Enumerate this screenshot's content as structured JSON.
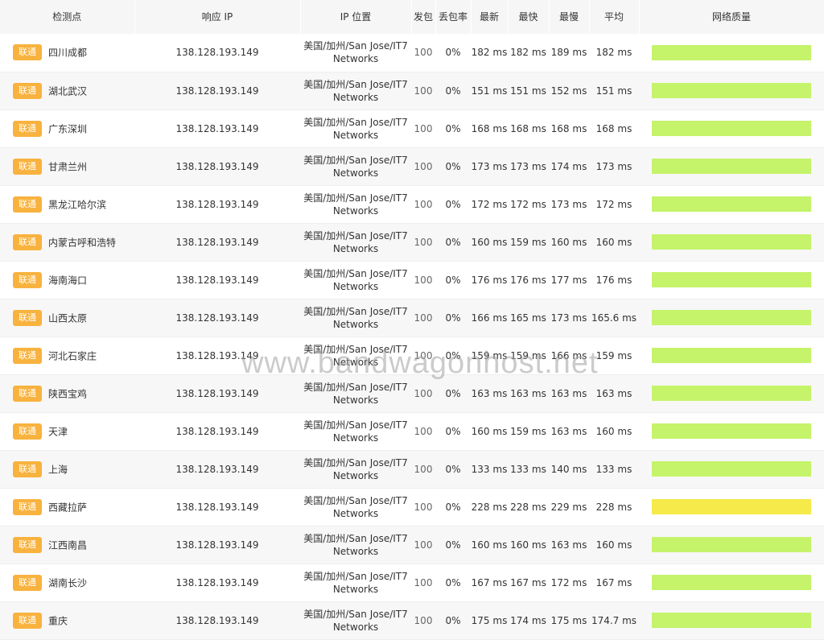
{
  "headers": {
    "point": "检测点",
    "ip": "响应 IP",
    "location": "IP 位置",
    "sent": "发包",
    "loss": "丢包率",
    "latest": "最新",
    "fastest": "最快",
    "slowest": "最慢",
    "average": "平均",
    "quality": "网络质量"
  },
  "isp_label": "联通",
  "colors": {
    "badge": "#f8b23e",
    "quality_good": "#c5f36a",
    "quality_fair": "#f6e94a"
  },
  "rows": [
    {
      "city": "四川成都",
      "ip": "138.128.193.149",
      "loc1": "美国/加州/San Jose/IT7",
      "loc2": "Networks",
      "sent": "100",
      "loss": "0%",
      "latest": "182 ms",
      "fastest": "182 ms",
      "slowest": "189 ms",
      "average": "182 ms",
      "quality": "good"
    },
    {
      "city": "湖北武汉",
      "ip": "138.128.193.149",
      "loc1": "美国/加州/San Jose/IT7",
      "loc2": "Networks",
      "sent": "100",
      "loss": "0%",
      "latest": "151 ms",
      "fastest": "151 ms",
      "slowest": "152 ms",
      "average": "151 ms",
      "quality": "good"
    },
    {
      "city": "广东深圳",
      "ip": "138.128.193.149",
      "loc1": "美国/加州/San Jose/IT7",
      "loc2": "Networks",
      "sent": "100",
      "loss": "0%",
      "latest": "168 ms",
      "fastest": "168 ms",
      "slowest": "168 ms",
      "average": "168 ms",
      "quality": "good"
    },
    {
      "city": "甘肃兰州",
      "ip": "138.128.193.149",
      "loc1": "美国/加州/San Jose/IT7",
      "loc2": "Networks",
      "sent": "100",
      "loss": "0%",
      "latest": "173 ms",
      "fastest": "173 ms",
      "slowest": "174 ms",
      "average": "173 ms",
      "quality": "good"
    },
    {
      "city": "黑龙江哈尔滨",
      "ip": "138.128.193.149",
      "loc1": "美国/加州/San Jose/IT7",
      "loc2": "Networks",
      "sent": "100",
      "loss": "0%",
      "latest": "172 ms",
      "fastest": "172 ms",
      "slowest": "173 ms",
      "average": "172 ms",
      "quality": "good"
    },
    {
      "city": "内蒙古呼和浩特",
      "ip": "138.128.193.149",
      "loc1": "美国/加州/San Jose/IT7",
      "loc2": "Networks",
      "sent": "100",
      "loss": "0%",
      "latest": "160 ms",
      "fastest": "159 ms",
      "slowest": "160 ms",
      "average": "160 ms",
      "quality": "good"
    },
    {
      "city": "海南海口",
      "ip": "138.128.193.149",
      "loc1": "美国/加州/San Jose/IT7",
      "loc2": "Networks",
      "sent": "100",
      "loss": "0%",
      "latest": "176 ms",
      "fastest": "176 ms",
      "slowest": "177 ms",
      "average": "176 ms",
      "quality": "good"
    },
    {
      "city": "山西太原",
      "ip": "138.128.193.149",
      "loc1": "美国/加州/San Jose/IT7",
      "loc2": "Networks",
      "sent": "100",
      "loss": "0%",
      "latest": "166 ms",
      "fastest": "165 ms",
      "slowest": "173 ms",
      "average": "165.6 ms",
      "quality": "good"
    },
    {
      "city": "河北石家庄",
      "ip": "138.128.193.149",
      "loc1": "美国/加州/San Jose/IT7",
      "loc2": "Networks",
      "sent": "100",
      "loss": "0%",
      "latest": "159 ms",
      "fastest": "159 ms",
      "slowest": "166 ms",
      "average": "159 ms",
      "quality": "good"
    },
    {
      "city": "陕西宝鸡",
      "ip": "138.128.193.149",
      "loc1": "美国/加州/San Jose/IT7",
      "loc2": "Networks",
      "sent": "100",
      "loss": "0%",
      "latest": "163 ms",
      "fastest": "163 ms",
      "slowest": "163 ms",
      "average": "163 ms",
      "quality": "good"
    },
    {
      "city": "天津",
      "ip": "138.128.193.149",
      "loc1": "美国/加州/San Jose/IT7",
      "loc2": "Networks",
      "sent": "100",
      "loss": "0%",
      "latest": "160 ms",
      "fastest": "159 ms",
      "slowest": "163 ms",
      "average": "160 ms",
      "quality": "good"
    },
    {
      "city": "上海",
      "ip": "138.128.193.149",
      "loc1": "美国/加州/San Jose/IT7",
      "loc2": "Networks",
      "sent": "100",
      "loss": "0%",
      "latest": "133 ms",
      "fastest": "133 ms",
      "slowest": "140 ms",
      "average": "133 ms",
      "quality": "good"
    },
    {
      "city": "西藏拉萨",
      "ip": "138.128.193.149",
      "loc1": "美国/加州/San Jose/IT7",
      "loc2": "Networks",
      "sent": "100",
      "loss": "0%",
      "latest": "228 ms",
      "fastest": "228 ms",
      "slowest": "229 ms",
      "average": "228 ms",
      "quality": "fair"
    },
    {
      "city": "江西南昌",
      "ip": "138.128.193.149",
      "loc1": "美国/加州/San Jose/IT7",
      "loc2": "Networks",
      "sent": "100",
      "loss": "0%",
      "latest": "160 ms",
      "fastest": "160 ms",
      "slowest": "163 ms",
      "average": "160 ms",
      "quality": "good"
    },
    {
      "city": "湖南长沙",
      "ip": "138.128.193.149",
      "loc1": "美国/加州/San Jose/IT7",
      "loc2": "Networks",
      "sent": "100",
      "loss": "0%",
      "latest": "167 ms",
      "fastest": "167 ms",
      "slowest": "172 ms",
      "average": "167 ms",
      "quality": "good"
    },
    {
      "city": "重庆",
      "ip": "138.128.193.149",
      "loc1": "美国/加州/San Jose/IT7",
      "loc2": "Networks",
      "sent": "100",
      "loss": "0%",
      "latest": "175 ms",
      "fastest": "174 ms",
      "slowest": "175 ms",
      "average": "174.7 ms",
      "quality": "good"
    }
  ],
  "watermark": "www.bandwagonhost.net"
}
